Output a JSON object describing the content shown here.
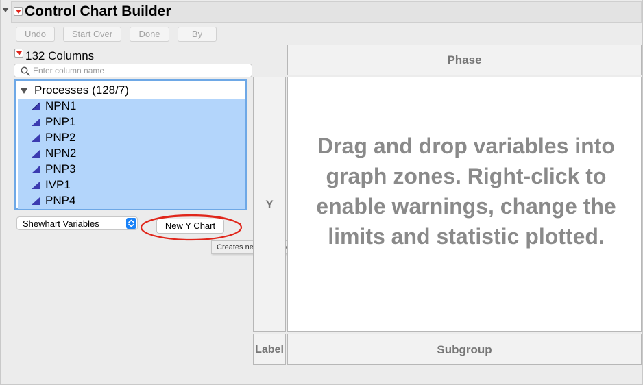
{
  "window": {
    "title": "Control Chart Builder"
  },
  "toolbar": {
    "undo": "Undo",
    "start_over": "Start Over",
    "done": "Done",
    "by": "By"
  },
  "columns_panel": {
    "title": "132 Columns",
    "search_placeholder": "Enter column name",
    "group_label": "Processes (128/7)",
    "items": [
      {
        "label": "NPN1"
      },
      {
        "label": "PNP1"
      },
      {
        "label": "PNP2"
      },
      {
        "label": "NPN2"
      },
      {
        "label": "PNP3"
      },
      {
        "label": "IVP1"
      },
      {
        "label": "PNP4"
      }
    ],
    "icon": "continuous-column-icon"
  },
  "chart_type_select": {
    "value": "Shewhart Variables"
  },
  "new_y_chart": {
    "label": "New Y Chart",
    "tooltip": "Creates new charts for all selected columns."
  },
  "zones": {
    "phase": "Phase",
    "y": "Y",
    "label": "Label",
    "subgroup": "Subgroup",
    "instructions": "Drag and drop variables into graph zones. Right-click to enable warnings, change the limits and statistic plotted."
  },
  "colors": {
    "selection": "#b3d5fb",
    "list_focus_border": "#6ea8e6",
    "annotation_red": "#e0261b",
    "select_stepper": "#1a82f7"
  }
}
